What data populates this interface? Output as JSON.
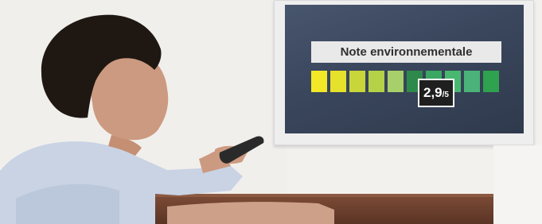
{
  "rating": {
    "title": "Note environnementale",
    "score": "2,9",
    "scale": "/5",
    "segment_colors": [
      "#f2e827",
      "#e6e12a",
      "#c9d63a",
      "#b5d247",
      "#a8d06a",
      "#2e8a4a",
      "#3aa863",
      "#48b870",
      "#4bb37a",
      "#2ea24e"
    ]
  },
  "colors": {
    "screen": "#3a465c",
    "frame": "#eeeeee",
    "shirt": "#c9d3e4",
    "skin": "#cc9a80",
    "hair": "#1f1812",
    "cabinet": "#6b3f2d",
    "remote": "#2a2a2a"
  }
}
